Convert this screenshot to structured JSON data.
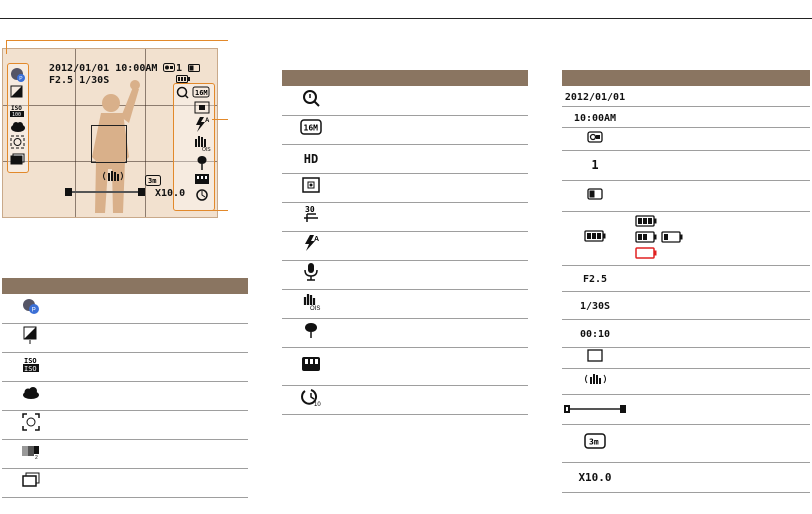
{
  "camera_preview": {
    "date": "2012/01/01",
    "time": "10:00AM",
    "frame_count": "1",
    "aperture": "F2.5",
    "shutter": "1/30S",
    "zoom_ratio": "X10.0"
  },
  "table1": {
    "rows": [
      {
        "icon": "smart-mode-icon"
      },
      {
        "icon": "exposure-value-icon"
      },
      {
        "icon": "iso-icon",
        "text": "ISO 100"
      },
      {
        "icon": "cloudy-white-balance-icon"
      },
      {
        "icon": "face-detection-icon"
      },
      {
        "icon": "photo-style-icon"
      },
      {
        "icon": "burst-mode-icon"
      }
    ]
  },
  "table2": {
    "rows": [
      {
        "icon": "intelli-zoom-icon"
      },
      {
        "icon": "photo-resolution-icon",
        "text": "16M"
      },
      {
        "icon": "video-resolution-icon",
        "text": "HD"
      },
      {
        "icon": "metering-icon"
      },
      {
        "icon": "frame-rate-icon",
        "text": "30"
      },
      {
        "icon": "flash-auto-icon"
      },
      {
        "icon": "voice-icon"
      },
      {
        "icon": "ois-icon"
      },
      {
        "icon": "macro-icon"
      },
      {
        "icon": "memory-icon"
      },
      {
        "icon": "self-timer-icon"
      }
    ]
  },
  "table3": {
    "rows": [
      {
        "text": "2012/01/01"
      },
      {
        "text": "10:00AM"
      },
      {
        "icon": "home-icon"
      },
      {
        "text": "1"
      },
      {
        "icon": "memory-card-icon"
      },
      {
        "icon": "battery-icon"
      },
      {
        "text": "F2.5"
      },
      {
        "text": "1/30S"
      },
      {
        "text": "00:10"
      },
      {
        "icon": "autofocus-frame-icon"
      },
      {
        "icon": "camera-shake-icon"
      },
      {
        "icon": "zoom-indicator-icon"
      },
      {
        "icon": "zoom-icon",
        "text": "3m"
      },
      {
        "text": "X10.0"
      }
    ]
  }
}
